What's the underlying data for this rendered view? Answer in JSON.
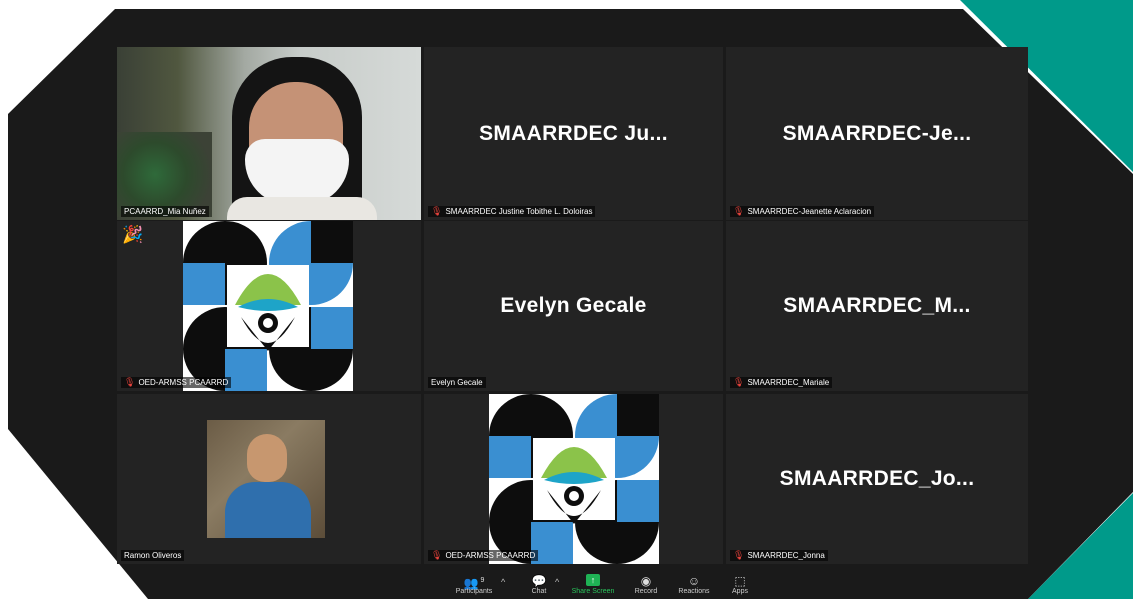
{
  "tiles": [
    {
      "label": "PCAARRD_Mia Nuñez",
      "big_name": ""
    },
    {
      "label": "SMAARRDEC Justine Tobithe L. Doloiras",
      "big_name": "SMAARRDEC  Ju..."
    },
    {
      "label": "SMAARRDEC-Jeanette Aclaracion",
      "big_name": "SMAARRDEC-Je..."
    },
    {
      "label": "OED-ARMSS PCAARRD",
      "big_name": "",
      "reaction": "🎉"
    },
    {
      "label": "Evelyn Gecale",
      "big_name": "Evelyn Gecale"
    },
    {
      "label": "SMAARRDEC_Mariale",
      "big_name": "SMAARRDEC_M..."
    },
    {
      "label": "Ramon Oliveros",
      "big_name": ""
    },
    {
      "label": "OED-ARMSS PCAARRD",
      "big_name": ""
    },
    {
      "label": "SMAARRDEC_Jonna",
      "big_name": "SMAARRDEC_Jo..."
    }
  ],
  "toolbar": {
    "participants_label": "Participants",
    "participants_count": "9",
    "chat_label": "Chat",
    "share_label": "Share Screen",
    "record_label": "Record",
    "reactions_label": "Reactions",
    "apps_label": "Apps"
  },
  "colors": {
    "active_speaker_border": "#d7e87a",
    "share_screen": "#1fb355",
    "muted_mic": "#e8433c",
    "teal_corner": "#009a8a"
  },
  "icons": [
    "muted-mic-icon",
    "participants-icon",
    "chat-icon",
    "share-screen-icon",
    "record-icon",
    "reactions-icon",
    "apps-icon",
    "caret-up-icon"
  ]
}
